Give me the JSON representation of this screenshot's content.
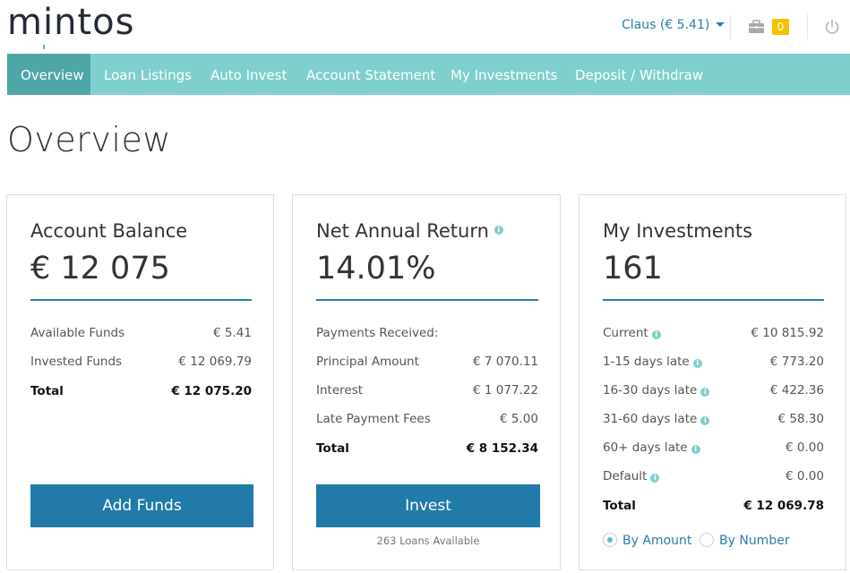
{
  "header": {
    "logo": "mintos",
    "user_label": "Claus (€ 5.41)",
    "cart_count": "0"
  },
  "nav": [
    {
      "label": "Overview"
    },
    {
      "label": "Loan Listings"
    },
    {
      "label": "Auto Invest"
    },
    {
      "label": "Account Statement"
    },
    {
      "label": "My Investments"
    },
    {
      "label": "Deposit / Withdraw"
    }
  ],
  "page_title": "Overview",
  "account_balance": {
    "title": "Account Balance",
    "value": "€ 12 075",
    "rows": [
      {
        "label": "Available Funds",
        "value": "€ 5.41"
      },
      {
        "label": "Invested Funds",
        "value": "€ 12 069.79"
      },
      {
        "label": "Total",
        "value": "€ 12 075.20"
      }
    ],
    "button": "Add Funds"
  },
  "net_return": {
    "title": "Net Annual Return",
    "value": "14.01%",
    "rows": [
      {
        "label": "Payments Received:",
        "value": ""
      },
      {
        "label": "Principal Amount",
        "value": "€ 7 070.11"
      },
      {
        "label": "Interest",
        "value": "€ 1 077.22"
      },
      {
        "label": "Late Payment Fees",
        "value": "€ 5.00"
      },
      {
        "label": "Total",
        "value": "€ 8 152.34"
      }
    ],
    "button": "Invest",
    "note": "263 Loans Available"
  },
  "my_investments": {
    "title": "My Investments",
    "value": "161",
    "rows": [
      {
        "label": "Current",
        "value": "€ 10 815.92"
      },
      {
        "label": "1-15 days late",
        "value": "€ 773.20"
      },
      {
        "label": "16-30 days late",
        "value": "€ 422.36"
      },
      {
        "label": "31-60 days late",
        "value": "€ 58.30"
      },
      {
        "label": "60+ days late",
        "value": "€ 0.00"
      },
      {
        "label": "Default",
        "value": "€ 0.00"
      },
      {
        "label": "Total",
        "value": "€ 12 069.78"
      }
    ],
    "radio_amount": "By Amount",
    "radio_number": "By Number",
    "selected": "By Amount"
  },
  "colors": {
    "nav_bg": "#7ecfcd",
    "nav_active": "#4ea6a7",
    "accent_blue": "#217aa7",
    "badge": "#f3c200"
  }
}
